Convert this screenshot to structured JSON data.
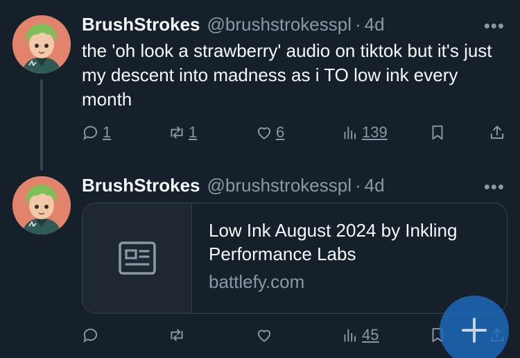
{
  "tweets": [
    {
      "author_name": "BrushStrokes",
      "handle": "@brushstrokesspl",
      "separator": "·",
      "time": "4d",
      "more": "•••",
      "text": "the 'oh look a strawberry' audio on tiktok but it's just my descent into madness as i TO low ink every month",
      "replies": "1",
      "retweets": "1",
      "likes": "6",
      "views": "139"
    },
    {
      "author_name": "BrushStrokes",
      "handle": "@brushstrokesspl",
      "separator": "·",
      "time": "4d",
      "more": "•••",
      "card": {
        "title": "Low Ink August 2024 by Inkling Performance Labs",
        "domain": "battlefy.com",
        "icon": "article-icon"
      },
      "replies": "",
      "retweets": "",
      "likes": "",
      "views": "45"
    }
  ],
  "icons": [
    "avatar",
    "reply-icon",
    "retweet-icon",
    "like-icon",
    "views-icon",
    "bookmark-icon",
    "share-icon",
    "compose-plus-icon"
  ],
  "colors": {
    "background": "#15202b",
    "text": "#f7f9f9",
    "muted": "#8b98a5",
    "border": "#38444d",
    "fab": "#1d6bbe"
  }
}
